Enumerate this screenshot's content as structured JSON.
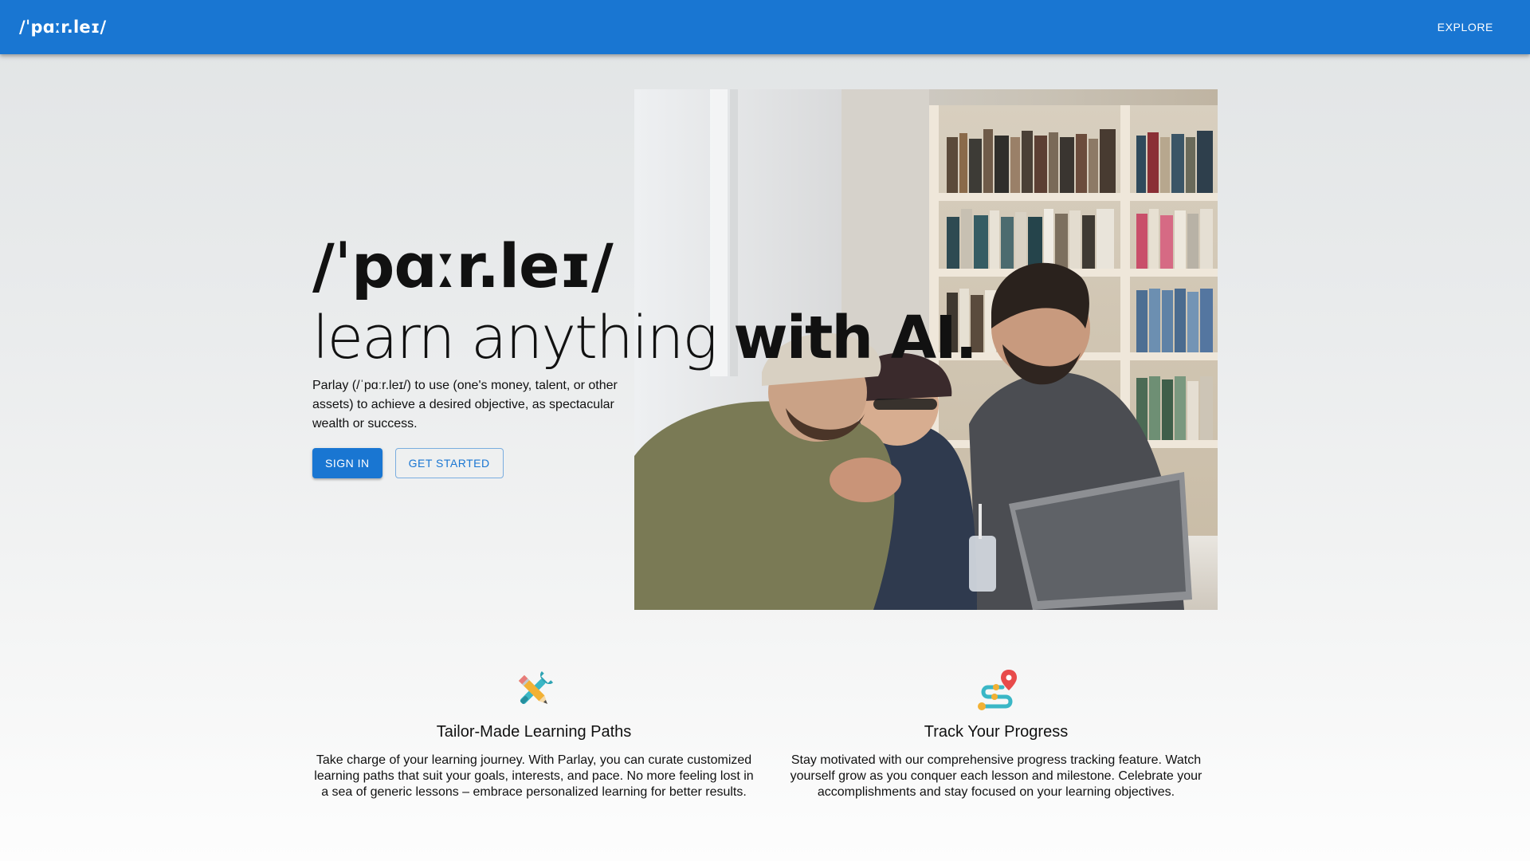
{
  "appbar": {
    "brand": "/ˈpɑːr.leɪ/",
    "explore_label": "EXPLORE",
    "background": "#1976d2"
  },
  "hero": {
    "title": "/ˈpɑːr.leɪ/",
    "subtitle_light": "learn anything ",
    "subtitle_bold": "with AI.",
    "description": "Parlay (/ˈpɑːr.leɪ/) to use (one's money, talent, or other assets) to achieve a desired objective, as spectacular wealth or success.",
    "sign_in_label": "SIGN IN",
    "get_started_label": "GET STARTED",
    "image_subject": "group-of-students-laughing-at-laptop-photo"
  },
  "features": [
    {
      "icon": "pencil-and-wrench-icon",
      "title": "Tailor-Made Learning Paths",
      "text": "Take charge of your learning journey. With Parlay, you can curate customized learning paths that suit your goals, interests, and pace. No more feeling lost in a sea of generic lessons – embrace personalized learning for better results."
    },
    {
      "icon": "route-with-pin-icon",
      "title": "Track Your Progress",
      "text": "Stay motivated with our comprehensive progress tracking feature. Watch yourself grow as you conquer each lesson and milestone. Celebrate your accomplishments and stay focused on your learning objectives."
    }
  ],
  "colors": {
    "primary": "#1976d2",
    "text": "#111111"
  }
}
